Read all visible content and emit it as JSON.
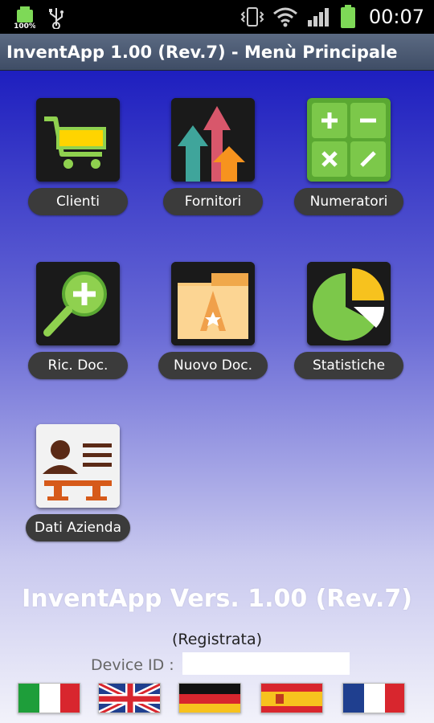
{
  "status_bar": {
    "battery_left_text": "100%",
    "time": "00:07",
    "icons": [
      "battery-icon",
      "usb-icon",
      "vibrate-icon",
      "wifi-icon",
      "signal-icon",
      "battery-full-icon"
    ]
  },
  "title_bar": {
    "title": "InventApp 1.00 (Rev.7) - Menù Principale"
  },
  "menu": {
    "items": [
      {
        "label": "Clienti",
        "icon": "shopping-cart-icon"
      },
      {
        "label": "Fornitori",
        "icon": "arrows-up-icon"
      },
      {
        "label": "Numeratori",
        "icon": "calculator-icon"
      },
      {
        "label": "Ric. Doc.",
        "icon": "magnifier-plus-icon"
      },
      {
        "label": "Nuovo Doc.",
        "icon": "folder-app-icon"
      },
      {
        "label": "Statistiche",
        "icon": "pie-chart-icon"
      },
      {
        "label": "Dati Azienda",
        "icon": "contact-card-icon"
      }
    ]
  },
  "footer": {
    "version": "InventApp Vers. 1.00 (Rev.7)",
    "registration": "(Registrata)",
    "device_id_label": "Device ID :",
    "device_id_value": "",
    "languages": [
      "italian-flag-icon",
      "english-flag-icon",
      "german-flag-icon",
      "spanish-flag-icon",
      "french-flag-icon"
    ]
  },
  "colors": {
    "background_top": "#1e1fbf",
    "background_bottom": "#f2f2fa",
    "title_bar": "#4b5973",
    "label_pill": "#3b3b3b"
  }
}
